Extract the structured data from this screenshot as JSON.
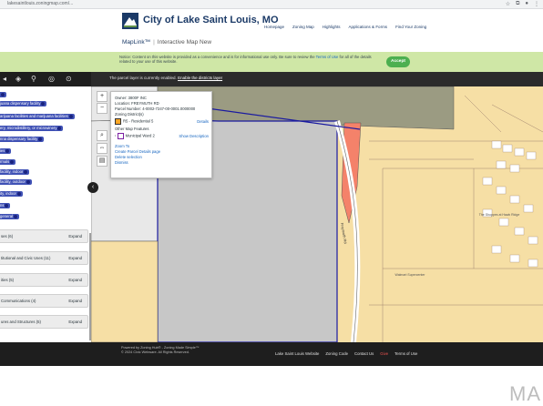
{
  "browser": {
    "url": "lakesaintlouis.zoningmap.com/..."
  },
  "header": {
    "city_name": "City of Lake Saint Louis, MO",
    "nav": [
      "Homepage",
      "Zoning Map",
      "Highlights",
      "Applications & Forms",
      "Find Your Zoning"
    ],
    "app_name": "MapLink™",
    "app_subtitle": "Interactive Map New"
  },
  "banner": {
    "text_a": "Notice: Content on this website is provided as a convenience and is for informational use only. Be sure to review the",
    "link": "Terms of Use",
    "text_b": "for all of the details related to your use of this website.",
    "accept_label": "Accept"
  },
  "map_notice": {
    "text": "The parcel layer is currently enabled.",
    "link": "Enable the districts layer"
  },
  "sidebar": {
    "layers": [
      "juana dispensary facility",
      "arijuana facilities and marijuana facilities",
      "ery, microdistillery, or microwinery",
      "nna dispensary facility",
      "ies",
      "rmals",
      "facility, indoor",
      "facility, outdoor",
      "ity, indoor",
      "ns",
      "general"
    ],
    "groups": [
      {
        "label": "ses (6)",
        "expand": "Expand"
      },
      {
        "label": "titutional and Civic Uses (11)",
        "expand": "Expand"
      },
      {
        "label": "ities (5)",
        "expand": "Expand"
      },
      {
        "label": "Communications (4)",
        "expand": "Expand"
      },
      {
        "label": "ures and Structures (5)",
        "expand": "Expand"
      }
    ]
  },
  "popup": {
    "owner": "Owner: 3800F INC",
    "location": "Location: FREYMUTH RD",
    "parcel": "Parcel Number: 4-0002-7247-00-0001.0000000",
    "zoning_header": "Zoning District(s)",
    "zoning_value": "R5 - Residential 5",
    "details": "Details",
    "other_header": "Other Map Features",
    "ward": "Municipal Ward 2",
    "show_description": "Show Description",
    "zoom_to": "Zoom To",
    "create_report": "Create Parcel Details page",
    "delete_selection": "Delete selection",
    "dismiss": "Dismiss"
  },
  "map_labels": {
    "road": "Freymuth Rd",
    "building_a": "The Shoppes at Hawk Ridge",
    "building_b": "Walmart Supercenter"
  },
  "footer": {
    "powered_by": "Powered by Zoning Hub® - Zoning Made Simple™",
    "copyright": "© 2024 Civic Webware. All Rights Reserved.",
    "links": [
      "Lake Saint Louis Website",
      "Zoning Code",
      "Contact Us",
      "Give",
      "Terms of Use"
    ]
  },
  "watermark": "MA",
  "colors": {
    "accent_blue": "#3f51b5",
    "accept_green": "#4caf50",
    "parcel_gray": "#c7c7c7",
    "parcel_olive": "#9b9b82",
    "parcel_tan": "#f6dfa5",
    "highlight_orange": "#f4826a"
  }
}
